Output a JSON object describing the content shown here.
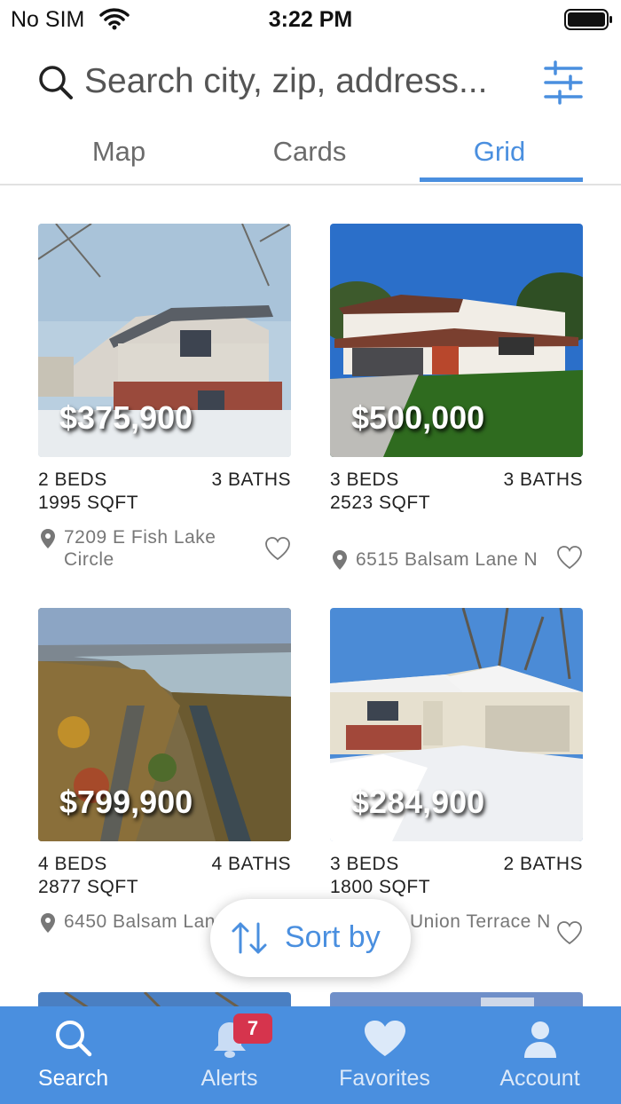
{
  "status_bar": {
    "carrier": "No SIM",
    "time": "3:22 PM"
  },
  "search": {
    "placeholder": "Search city, zip, address..."
  },
  "tabs": [
    {
      "label": "Map",
      "active": false
    },
    {
      "label": "Cards",
      "active": false
    },
    {
      "label": "Grid",
      "active": true
    }
  ],
  "listings": [
    {
      "price": "$375,900",
      "beds": "2 BEDS",
      "baths": "3 BATHS",
      "sqft": "1995 SQFT",
      "address": "7209 E Fish Lake Circle",
      "favorited": false
    },
    {
      "price": "$500,000",
      "beds": "3 BEDS",
      "baths": "3 BATHS",
      "sqft": "2523 SQFT",
      "address": "6515 Balsam Lane N",
      "favorited": false
    },
    {
      "price": "$799,900",
      "beds": "4 BEDS",
      "baths": "4 BATHS",
      "sqft": "2877 SQFT",
      "address": "6450 Balsam Lane N",
      "favorited": false
    },
    {
      "price": "$284,900",
      "beds": "3 BEDS",
      "baths": "2 BATHS",
      "sqft": "1800 SQFT",
      "address": "Union Terrace N",
      "favorited": false
    }
  ],
  "sort": {
    "label": "Sort by"
  },
  "bottom_nav": [
    {
      "label": "Search",
      "icon": "search-icon",
      "active": true
    },
    {
      "label": "Alerts",
      "icon": "bell-icon",
      "active": false,
      "badge": "7"
    },
    {
      "label": "Favorites",
      "icon": "heart-icon",
      "active": false
    },
    {
      "label": "Account",
      "icon": "person-icon",
      "active": false
    }
  ],
  "colors": {
    "accent": "#4a8fdf",
    "nav_bg": "#4a8fdf",
    "badge": "#d6344d"
  }
}
